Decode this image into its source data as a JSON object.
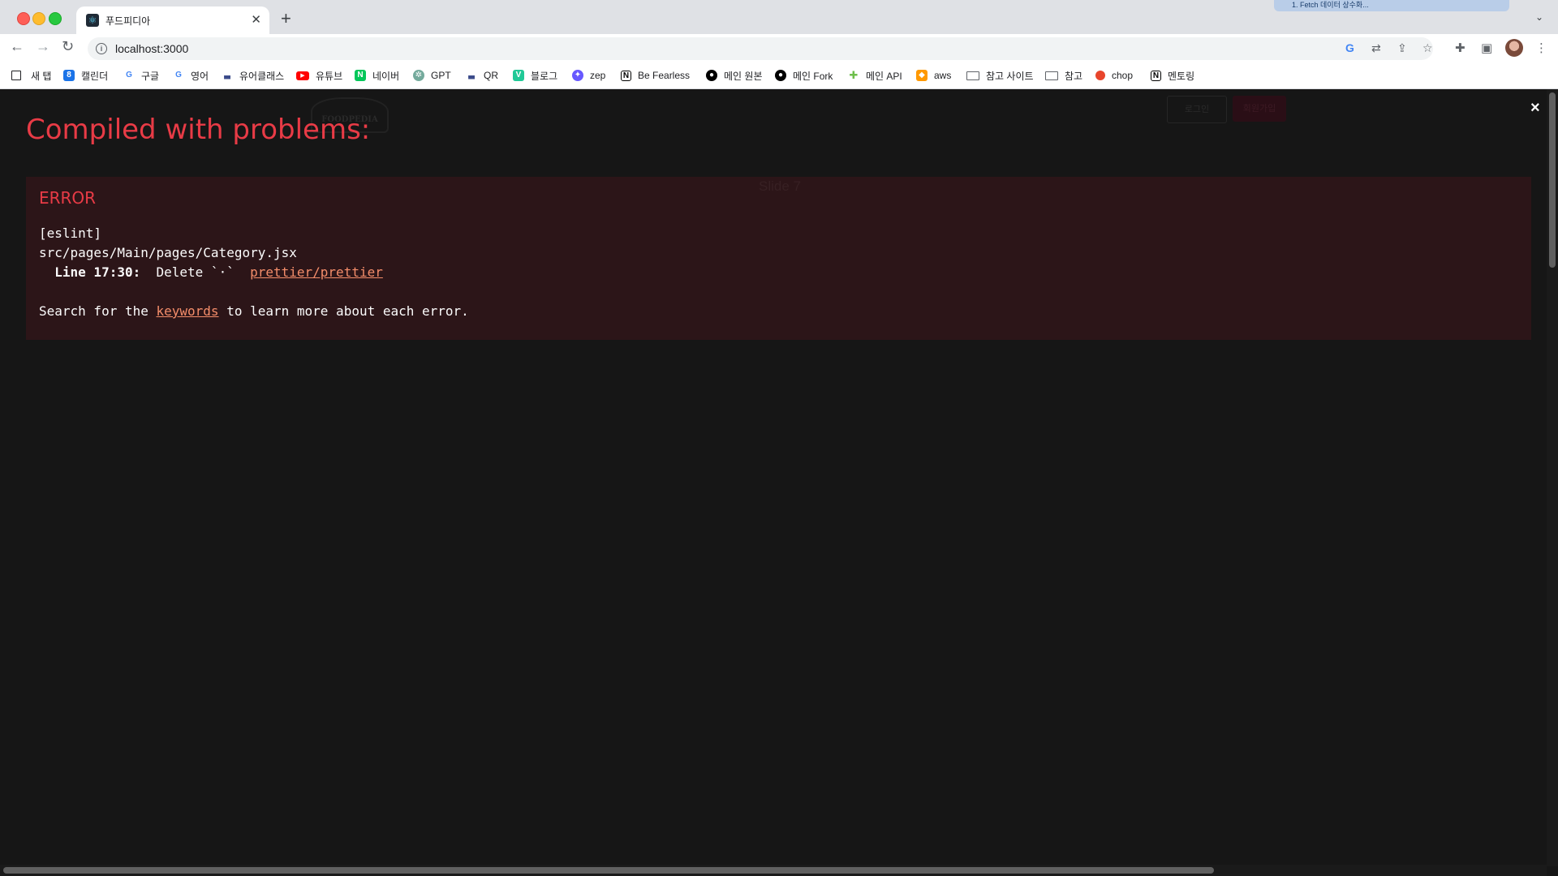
{
  "browser": {
    "tab_title": "푸드피디아",
    "extension_notice": "1. Fetch 데이터 상수화...",
    "url": "localhost:3000",
    "bookmarks": [
      {
        "label": "새 탭",
        "icon": "new-tab-icon",
        "color": "#202124"
      },
      {
        "label": "캘린더",
        "icon": "calendar-icon",
        "color": "#1a73e8"
      },
      {
        "label": "구글",
        "icon": "google-icon",
        "color": "#4285f4"
      },
      {
        "label": "영어",
        "icon": "google-icon",
        "color": "#4285f4"
      },
      {
        "label": "유어클래스",
        "icon": "urclass-icon",
        "color": "#3b4b8a"
      },
      {
        "label": "유튜브",
        "icon": "youtube-icon",
        "color": "#ff0000"
      },
      {
        "label": "네이버",
        "icon": "naver-icon",
        "color": "#03c75a"
      },
      {
        "label": "GPT",
        "icon": "openai-icon",
        "color": "#74aa9c"
      },
      {
        "label": "QR",
        "icon": "qr-icon",
        "color": "#3b4b8a"
      },
      {
        "label": "블로그",
        "icon": "velog-icon",
        "color": "#20c997"
      },
      {
        "label": "zep",
        "icon": "zep-icon",
        "color": "#6758ff"
      },
      {
        "label": "Be Fearless",
        "icon": "notion-icon",
        "color": "#000000"
      },
      {
        "label": "메인 원본",
        "icon": "github-icon",
        "color": "#000000"
      },
      {
        "label": "메인 Fork",
        "icon": "github-icon",
        "color": "#000000"
      },
      {
        "label": "메인 API",
        "icon": "puzzle-icon",
        "color": "#6dbf4b"
      },
      {
        "label": "aws",
        "icon": "aws-icon",
        "color": "#ff9900"
      },
      {
        "label": "참고 사이트",
        "icon": "folder-icon",
        "color": "#5f6368"
      },
      {
        "label": "참고",
        "icon": "folder-icon",
        "color": "#5f6368"
      },
      {
        "label": "chop",
        "icon": "tomato-icon",
        "color": "#e8452c"
      },
      {
        "label": "멘토링",
        "icon": "notion-icon",
        "color": "#000000"
      }
    ]
  },
  "underlay": {
    "logo_text": "FOODPEDIA",
    "login_label": "로그인",
    "signup_label": "회원가입",
    "slide_label": "Slide 7"
  },
  "overlay": {
    "title": "Compiled with problems:",
    "close_symbol": "×",
    "error_header": "ERROR",
    "source": "[eslint]",
    "file_path": "src/pages/Main/pages/Category.jsx",
    "line_ref": "Line 17:30:",
    "message": "Delete `·`",
    "rule_link": "prettier/prettier",
    "hint_prefix": "Search for the ",
    "hint_link": "keywords",
    "hint_suffix": " to learn more about each error."
  },
  "colors": {
    "overlay_bg": "#1a1a1a",
    "error_red": "#e83b46",
    "link_orange": "#f48d6a"
  }
}
